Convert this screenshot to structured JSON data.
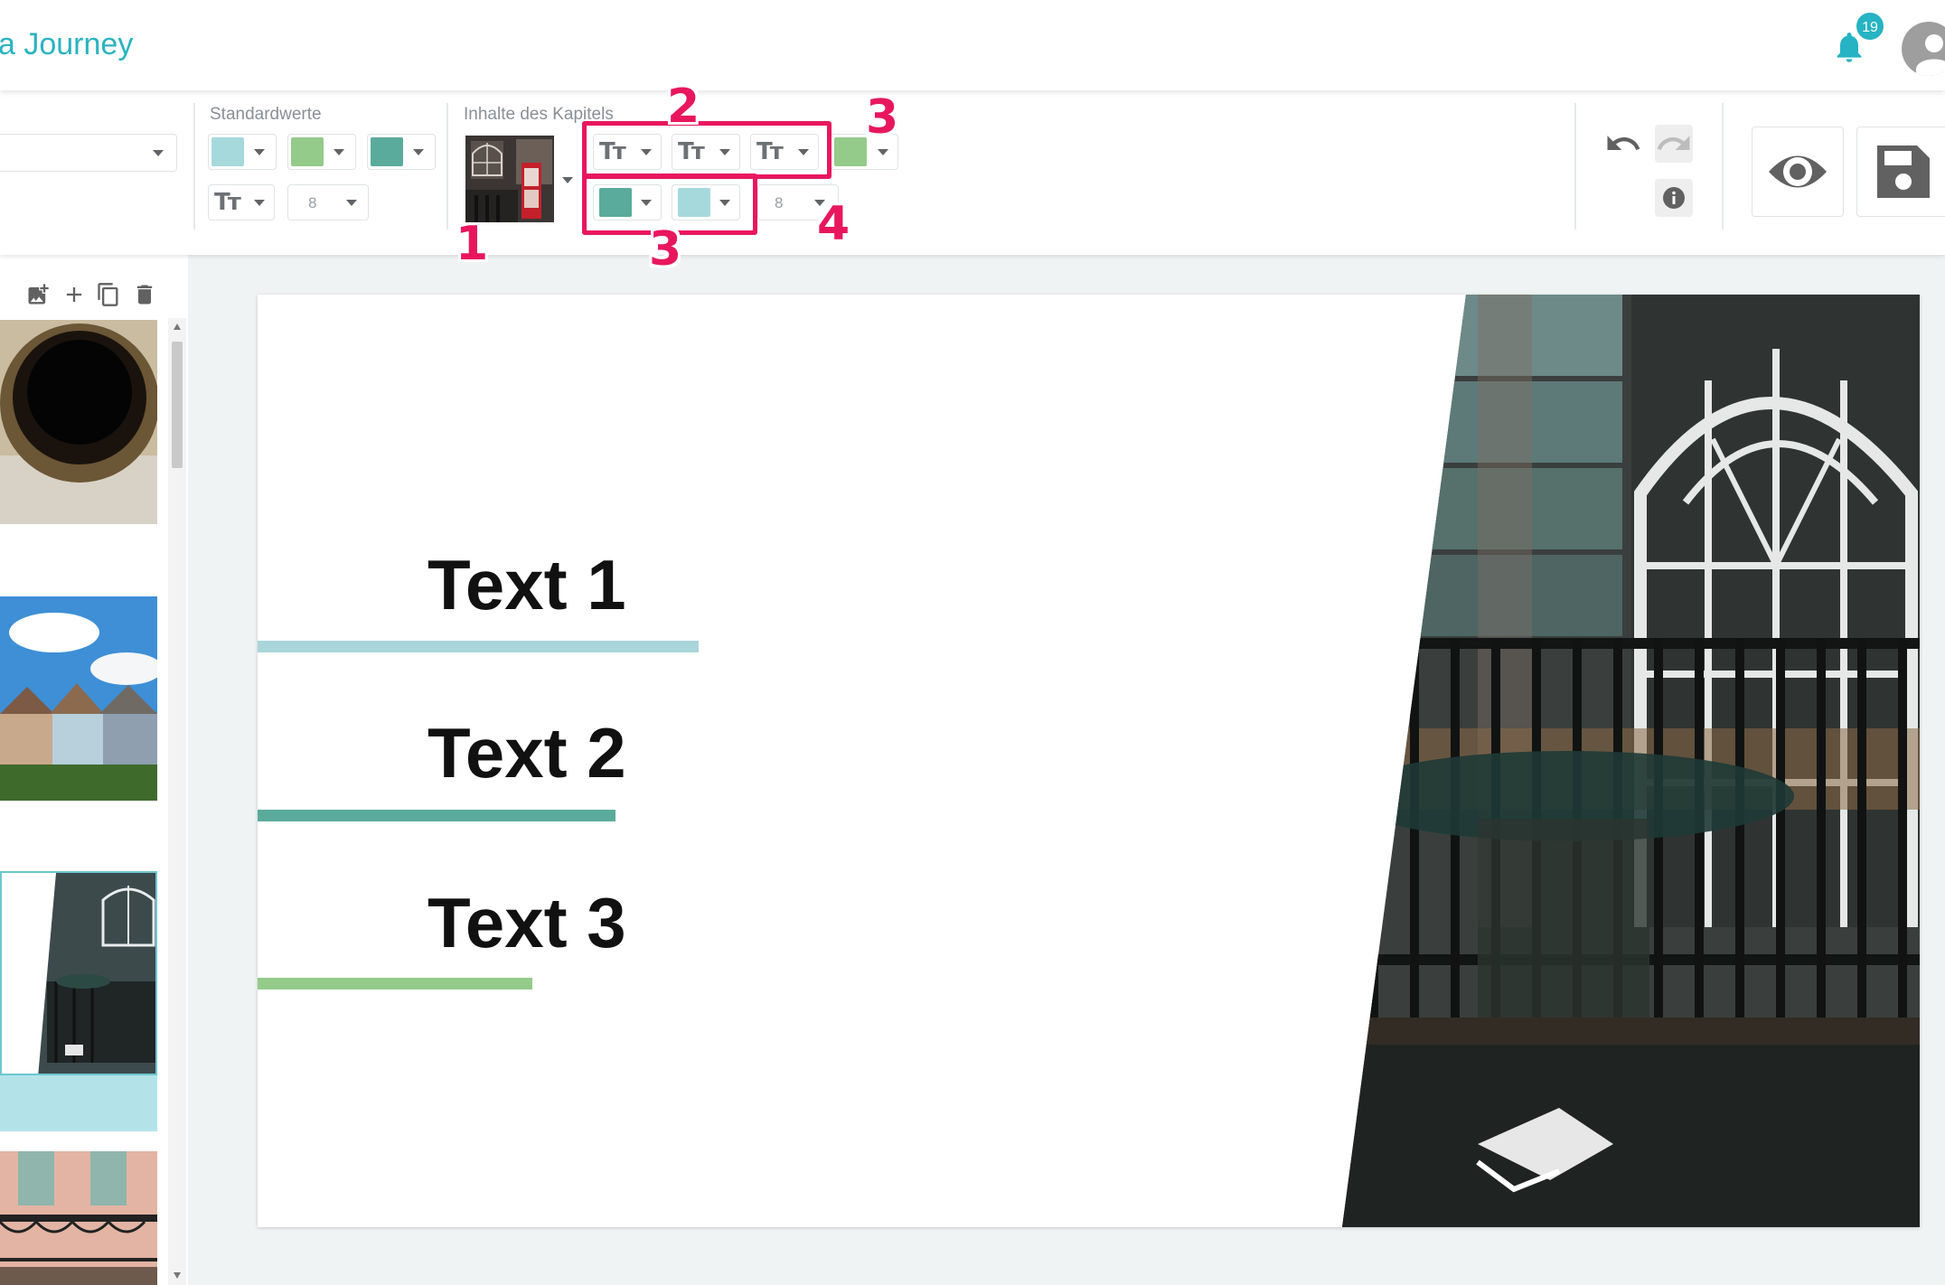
{
  "header": {
    "app_title": "a Journey",
    "notification_count": "19"
  },
  "toolbar": {
    "standard_label": "Standardwerte",
    "chapter_label": "Inhalte des Kapitels",
    "standard_font_size": "8",
    "chapter_font_size": "8",
    "colors": {
      "light_blue": "#a6d9dc",
      "light_green": "#94cb8a",
      "teal": "#5aab9b"
    }
  },
  "annotations": {
    "n1": "1",
    "n2": "2",
    "n3a": "3",
    "n3b": "3",
    "n4": "4"
  },
  "slide": {
    "items": [
      {
        "label": "Text 1",
        "bar_color": "#aad6d9"
      },
      {
        "label": "Text 2",
        "bar_color": "#5aab9b"
      },
      {
        "label": "Text 3",
        "bar_color": "#94cb8a"
      }
    ]
  }
}
